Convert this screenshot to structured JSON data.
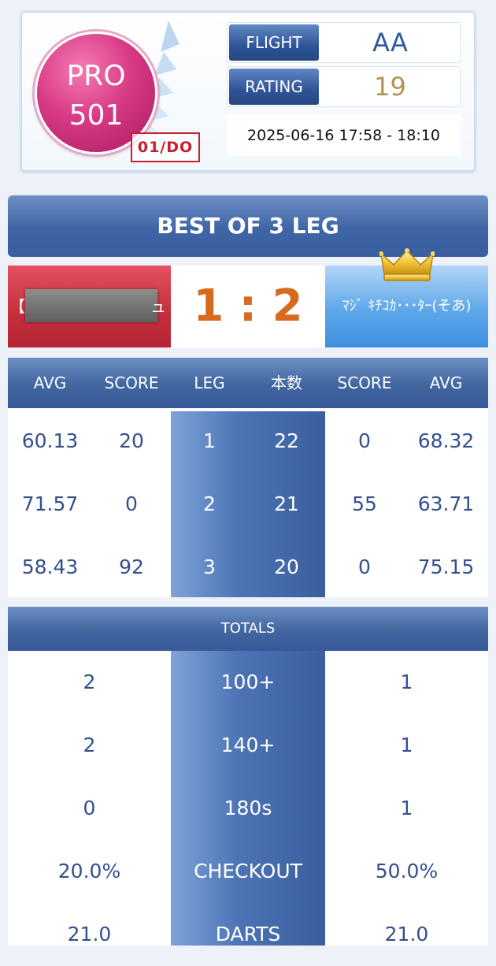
{
  "game": {
    "name_line1": "PRO",
    "name_line2": "501",
    "stamp": "01/DO",
    "flight_label": "FLIGHT",
    "flight_value": "AA",
    "rating_label": "RATING",
    "rating_value": "19",
    "datetime": "2025-06-16 17:58 - 18:10"
  },
  "match": {
    "title": "BEST OF 3 LEG",
    "player1_prefix": "【",
    "player1_suffix": "ュ",
    "player2_name": "ﾏｼﾞ ｷﾁｺｶ･･･ﾀｰ(そあ)",
    "score": "1 : 2",
    "colors": {
      "player1": "#c52f3c",
      "player2": "#4f9be6",
      "score": "#d86a1f",
      "header_blue": "#3f65a7",
      "value_text": "#33508e"
    }
  },
  "legs": {
    "headers": [
      "AVG",
      "SCORE",
      "LEG",
      "本数",
      "SCORE",
      "AVG"
    ],
    "rows": [
      {
        "p1_avg": "60.13",
        "p1_score": "20",
        "leg": "1",
        "darts": "22",
        "p2_score": "0",
        "p2_avg": "68.32"
      },
      {
        "p1_avg": "71.57",
        "p1_score": "0",
        "leg": "2",
        "darts": "21",
        "p2_score": "55",
        "p2_avg": "63.71"
      },
      {
        "p1_avg": "58.43",
        "p1_score": "92",
        "leg": "3",
        "darts": "20",
        "p2_score": "0",
        "p2_avg": "75.15"
      }
    ]
  },
  "totals": {
    "title": "TOTALS",
    "rows": [
      {
        "label": "100+",
        "p1": "2",
        "p2": "1"
      },
      {
        "label": "140+",
        "p1": "2",
        "p2": "1"
      },
      {
        "label": "180s",
        "p1": "0",
        "p2": "1"
      },
      {
        "label": "CHECKOUT",
        "p1": "20.0%",
        "p2": "50.0%"
      },
      {
        "label": "DARTS",
        "p1": "21.0",
        "p2": "21.0"
      }
    ]
  }
}
